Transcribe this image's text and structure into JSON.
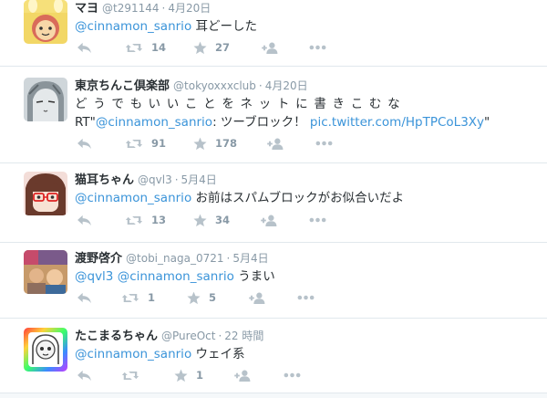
{
  "colors": {
    "accent": "#3b94d9",
    "muted": "#8899a6",
    "icon": "#b7c2ca",
    "divider": "#e1e8ed"
  },
  "tweets": [
    {
      "name": "マヨ",
      "handle": "@t291144",
      "time": "4月20日",
      "mention": "@cinnamon_sanrio",
      "text": " 耳どーした",
      "retweets": "14",
      "favorites": "27",
      "avatar": "mayo-avatar"
    },
    {
      "name": "東京ちんこ倶楽部",
      "handle": "@tokyoxxxclub",
      "time": "4月20日",
      "line1": "どうでもいいことをネットに書きこむな",
      "rt_prefix": "RT\"",
      "mention": "@cinnamon_sanrio",
      "rt_mid": ": ツーブロック！ ",
      "link": "pic.twitter.com/HpTPCoL3Xy",
      "rt_suffix": "\"",
      "retweets": "91",
      "favorites": "178",
      "avatar": "tokyo-club-avatar"
    },
    {
      "name": "猫耳ちゃん",
      "handle": "@qvl3",
      "time": "5月4日",
      "mention": "@cinnamon_sanrio",
      "text": " お前はスパムブロックがお似合いだよ",
      "retweets": "13",
      "favorites": "34",
      "avatar": "nekomimi-avatar"
    },
    {
      "name": "渡野啓介",
      "handle": "@tobi_naga_0721",
      "time": "5月4日",
      "mention1": "@qvl3",
      "mention2": "@cinnamon_sanrio",
      "text": " うまい",
      "retweets": "1",
      "favorites": "5",
      "avatar": "watano-avatar"
    },
    {
      "name": "たこまるちゃん",
      "handle": "@PureOct",
      "time": "22 時間",
      "mention": "@cinnamon_sanrio",
      "text": " ウェイ系",
      "retweets": "",
      "favorites": "1",
      "avatar": "takomaru-avatar"
    }
  ]
}
